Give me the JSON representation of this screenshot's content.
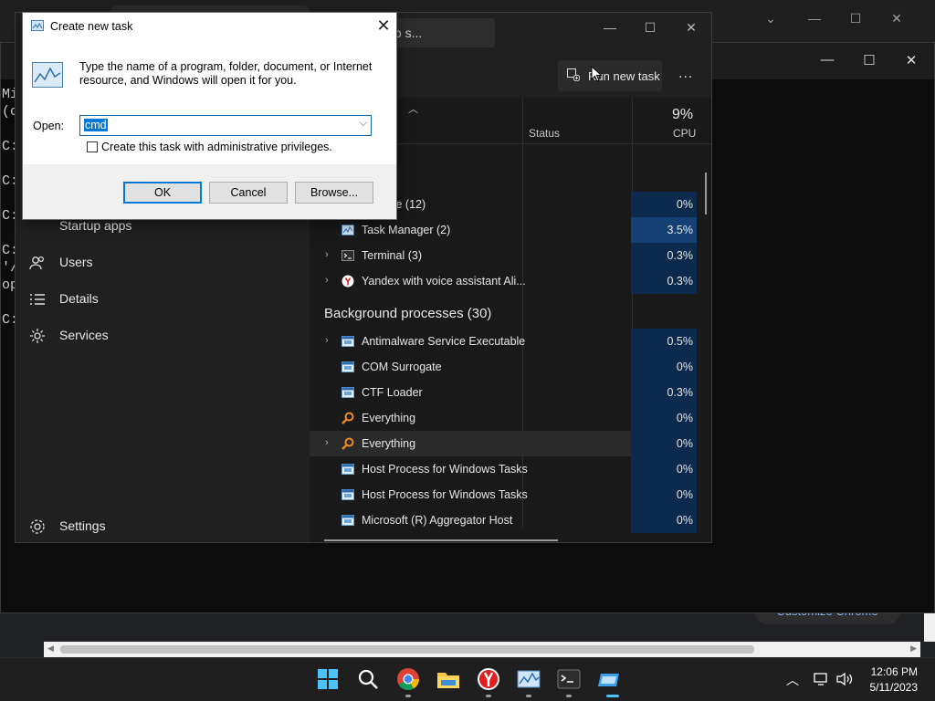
{
  "chrome": {
    "customize_label": "Customize Chrome"
  },
  "terminal": {
    "lines": [
      "Mi",
      "(c",
      "",
      "C:",
      "",
      "C:",
      "",
      "C:",
      "",
      "C:",
      "'/",
      "op",
      "",
      "C:"
    ]
  },
  "task_manager": {
    "search_placeholder": "er, or PID to s...",
    "run_new_task_label": "Run new task",
    "more_label": "...",
    "nav": {
      "startup_apps": "Startup apps",
      "users": "Users",
      "details": "Details",
      "services": "Services",
      "settings": "Settings"
    },
    "columns": {
      "status": "Status",
      "cpu": "CPU",
      "cpu_total": "9%"
    },
    "apps": [
      {
        "name": "Chrome (12)",
        "cpu": "0%",
        "icon": "chrome-icon",
        "expandable": false
      },
      {
        "name": "Task Manager (2)",
        "cpu": "3.5%",
        "icon": "task-manager-icon",
        "expandable": false
      },
      {
        "name": "Terminal (3)",
        "cpu": "0.3%",
        "icon": "terminal-icon",
        "expandable": true
      },
      {
        "name": "Yandex with voice assistant Ali...",
        "cpu": "0.3%",
        "icon": "yandex-icon",
        "expandable": true
      }
    ],
    "background_heading": "Background processes (30)",
    "background": [
      {
        "name": "Antimalware Service Executable",
        "cpu": "0.5%",
        "icon": "service-icon",
        "expandable": true
      },
      {
        "name": "COM Surrogate",
        "cpu": "0%",
        "icon": "service-icon",
        "expandable": false
      },
      {
        "name": "CTF Loader",
        "cpu": "0.3%",
        "icon": "service-icon",
        "expandable": false
      },
      {
        "name": "Everything",
        "cpu": "0%",
        "icon": "search-icon",
        "expandable": false
      },
      {
        "name": "Everything",
        "cpu": "0%",
        "icon": "search-icon",
        "expandable": true
      },
      {
        "name": "Host Process for Windows Tasks",
        "cpu": "0%",
        "icon": "service-icon",
        "expandable": false
      },
      {
        "name": "Host Process for Windows Tasks",
        "cpu": "0%",
        "icon": "service-icon",
        "expandable": false
      },
      {
        "name": "Microsoft (R) Aggregator Host",
        "cpu": "0%",
        "icon": "service-icon",
        "expandable": false
      }
    ]
  },
  "run_dialog": {
    "title": "Create new task",
    "description": "Type the name of a program, folder, document, or Internet resource, and Windows will open it for you.",
    "open_label": "Open:",
    "input_value": "cmd",
    "admin_checkbox_label": "Create this task with administrative privileges.",
    "admin_checked": false,
    "ok_label": "OK",
    "cancel_label": "Cancel",
    "browse_label": "Browse..."
  },
  "taskbar": {
    "apps": [
      "start-icon",
      "search-icon",
      "chrome-icon",
      "file-explorer-icon",
      "yandex-icon",
      "task-manager-icon",
      "terminal-icon",
      "app-icon"
    ],
    "time": "12:06 PM",
    "date": "5/11/2023"
  },
  "colors": {
    "accent": "#0078d7",
    "cpu_heat_low": "#0c2a4d",
    "cpu_heat_high": "#154074"
  }
}
